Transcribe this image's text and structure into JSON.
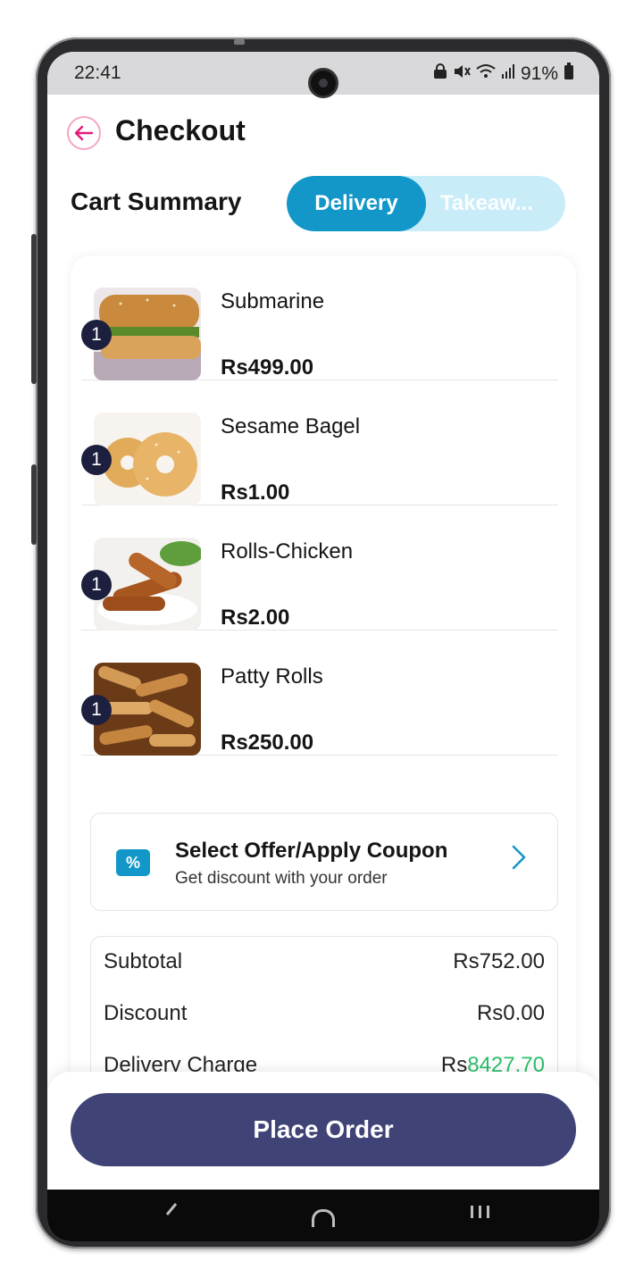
{
  "status_bar": {
    "time": "22:41",
    "battery": "91%"
  },
  "header": {
    "title": "Checkout",
    "back_icon": "arrow-left-icon"
  },
  "cart": {
    "section_title": "Cart Summary",
    "mode_toggle": {
      "options": [
        "Delivery",
        "Takeaw..."
      ],
      "selected": "Delivery"
    },
    "items": [
      {
        "name": "Submarine",
        "price": "Rs499.00",
        "qty": "1"
      },
      {
        "name": "Sesame Bagel",
        "price": "Rs1.00",
        "qty": "1"
      },
      {
        "name": "Rolls-Chicken",
        "price": "Rs2.00",
        "qty": "1"
      },
      {
        "name": "Patty Rolls",
        "price": "Rs250.00",
        "qty": "1"
      }
    ]
  },
  "coupon": {
    "title": "Select Offer/Apply Coupon",
    "subtitle": "Get discount with your order",
    "icon": "percent-ticket-icon"
  },
  "summary": {
    "rows": [
      {
        "label": "Subtotal",
        "currency": "Rs",
        "amount": "752.00"
      },
      {
        "label": "Discount",
        "currency": "Rs",
        "amount": "0.00"
      },
      {
        "label": "Delivery Charge",
        "currency": "Rs",
        "amount": "8427.70"
      }
    ]
  },
  "actions": {
    "place_order": "Place Order"
  },
  "colors": {
    "accent": "#1397c8",
    "primary_button": "#3f4375",
    "badge": "#1c1f3d",
    "delivery_amount": "#2bbf6a",
    "back_icon": "#e3197a"
  }
}
